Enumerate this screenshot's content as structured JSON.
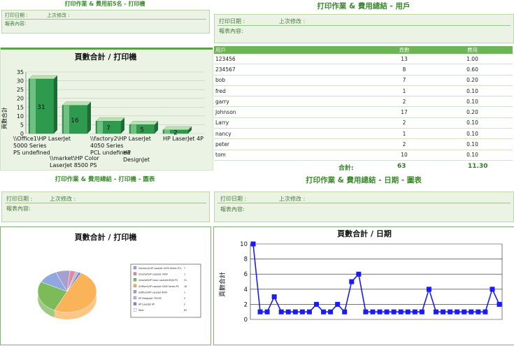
{
  "titles": {
    "top_left": "打印作業 & 費用前5名 - 打印機",
    "top_right": "打印作業 & 費用總結 - 用戶",
    "bottom_left": "打印作業 & 費用總結 - 打印機 - 圖表",
    "bottom_right": "打印作業 & 費用總結 - 日期 - 圖表"
  },
  "header_fields": {
    "print_date": "打印日期 :",
    "print_date_value": "",
    "last_modified": "上次修改 :",
    "last_modified_value": "",
    "report_content": "報表內容:"
  },
  "user_table": {
    "columns": [
      "用戶",
      "頁數",
      "費用"
    ],
    "rows": [
      [
        "123456",
        "13",
        "1.00"
      ],
      [
        "234567",
        "8",
        "0.60"
      ],
      [
        "bob",
        "7",
        "0.20"
      ],
      [
        "fred",
        "1",
        "0.10"
      ],
      [
        "garry",
        "2",
        "0.10"
      ],
      [
        "Johnson",
        "17",
        "0.20"
      ],
      [
        "Larry",
        "2",
        "0.10"
      ],
      [
        "nancy",
        "1",
        "0.10"
      ],
      [
        "peter",
        "2",
        "0.10"
      ],
      [
        "tom",
        "10",
        "0.10"
      ]
    ],
    "total_label": "合計:",
    "total_pages": "63",
    "total_cost": "11.30"
  },
  "colors": {
    "accent": "#3c8a2e",
    "bar": "#2e9a4e",
    "line": "#1a1aff",
    "panel_bg": "#eaf3e4"
  },
  "chart_data": [
    {
      "type": "bar",
      "title": "頁數合計 / 打印機",
      "ylabel": "頁數合計",
      "categories": [
        "\\\\Office1\\HP LaserJet 5000 Series PS",
        "\\\\factory2\\HP LaserJet 4050 Series PCL",
        "\\\\market\\HP Color LaserJet 8500 PS",
        "HP DesignJet 755CM",
        "HP LaserJet 4P"
      ],
      "values": [
        31,
        16,
        7,
        5,
        2
      ],
      "ylim": [
        0,
        35
      ],
      "yticks": [
        0,
        5,
        10,
        15,
        20,
        25,
        30,
        35
      ],
      "grid": true
    },
    {
      "type": "pie",
      "title": "頁數合計 / 打印機",
      "slices": [
        {
          "value": 31,
          "color": "#fbb35a"
        },
        {
          "value": 16,
          "color": "#7cba5a"
        },
        {
          "value": 7,
          "color": "#8fa8e0"
        },
        {
          "value": 5,
          "color": "#a6a0d0"
        },
        {
          "value": 2,
          "color": "#e08aa0"
        },
        {
          "value": 1,
          "color": "#c9b2d9"
        },
        {
          "value": 1,
          "color": "#6d8fd6"
        }
      ],
      "legend": [
        "\\\\factory2\\HP LaserJet 4050 Series PCL",
        "\\\\market\\HP LaserJet 4000",
        "\\\\market\\HP Color LaserJet 8500 PS",
        "\\\\Office1\\HP LaserJet 5000 Series PS",
        "\\\\office2\\HP LaserJet 4000",
        "HP DesignJet 755CM",
        "HP LaserJet 4P",
        "Total"
      ],
      "legend_pages": [
        "7",
        "1",
        "31",
        "16",
        "1",
        "5",
        "2",
        "63"
      ]
    },
    {
      "type": "line",
      "title": "頁數合計 / 日期",
      "ylabel": "頁數合計",
      "values": [
        10,
        1,
        1,
        3,
        1,
        1,
        1,
        1,
        1,
        2,
        1,
        1,
        2,
        1,
        5,
        6,
        1,
        1,
        1,
        1,
        1,
        1,
        1,
        1,
        1,
        4,
        1,
        1,
        1,
        1,
        1,
        1,
        1,
        1,
        4,
        2
      ],
      "ylim": [
        0,
        10
      ],
      "yticks": [
        0,
        2,
        4,
        6,
        8,
        10
      ],
      "grid": true
    }
  ]
}
